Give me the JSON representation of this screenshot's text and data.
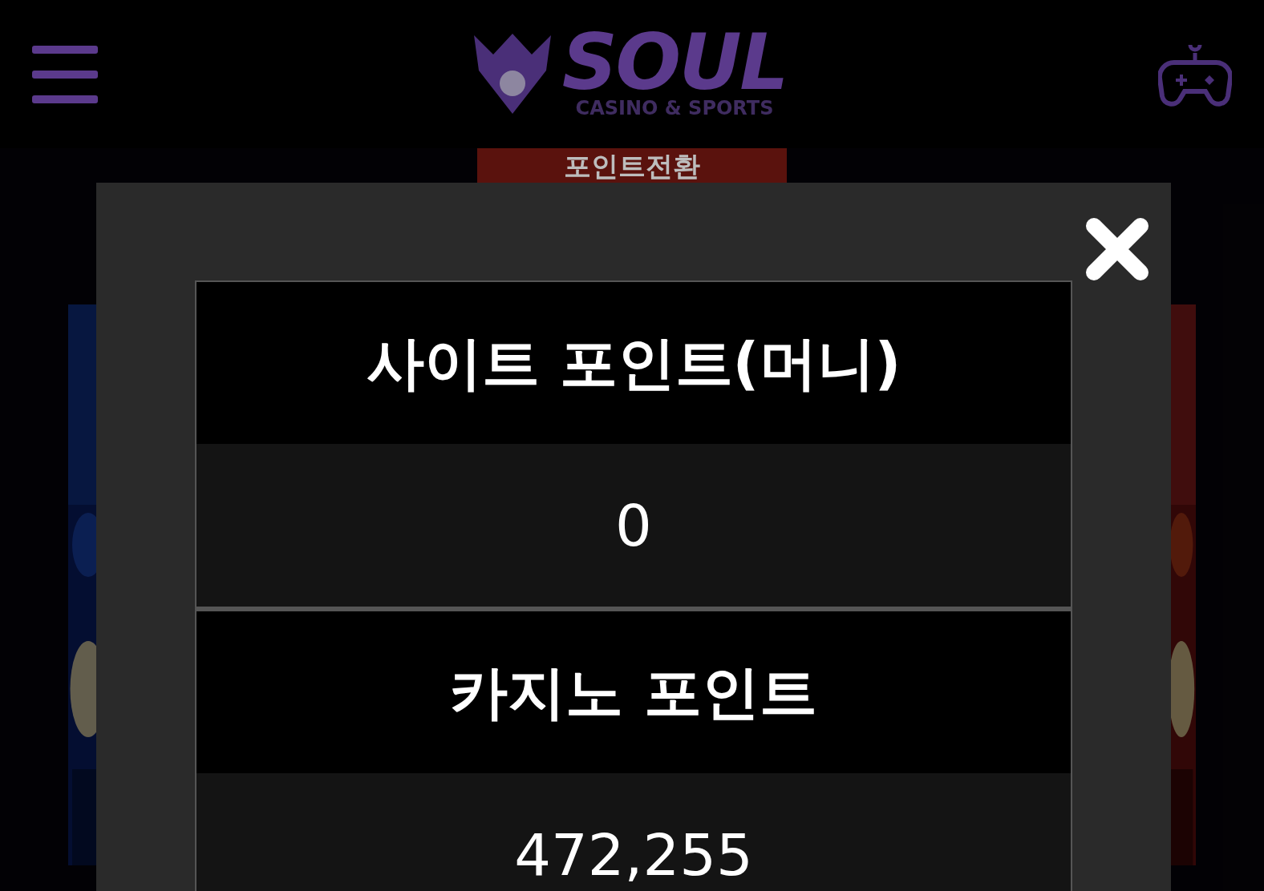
{
  "header": {
    "logo": {
      "title": "SOUL",
      "subtitle": "CASINO & SPORTS"
    }
  },
  "page": {
    "action_button": "포인트전환"
  },
  "modal": {
    "rows": [
      {
        "label": "사이트 포인트(머니)",
        "value": "0"
      },
      {
        "label": "카지노 포인트",
        "value": "472,255"
      }
    ]
  }
}
